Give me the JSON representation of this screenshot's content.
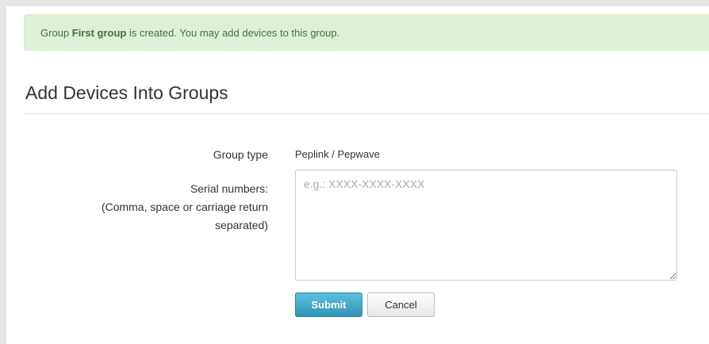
{
  "alert": {
    "prefix": "Group ",
    "group_name": "First group",
    "suffix": " is created. You may add devices to this group."
  },
  "page": {
    "title": "Add Devices Into Groups"
  },
  "form": {
    "group_type": {
      "label": "Group type",
      "value": "Peplink / Pepwave"
    },
    "serial_numbers": {
      "label_line1": "Serial numbers:",
      "label_line2": "(Comma, space or carriage return",
      "label_line3": "separated)",
      "placeholder": "e.g.: XXXX-XXXX-XXXX",
      "value": ""
    },
    "submit_label": "Submit",
    "cancel_label": "Cancel"
  },
  "colors": {
    "alert_bg": "#dff0d8",
    "alert_text": "#3c763d",
    "submit_bg": "#49afcd",
    "page_bg": "#e6e6e6"
  }
}
